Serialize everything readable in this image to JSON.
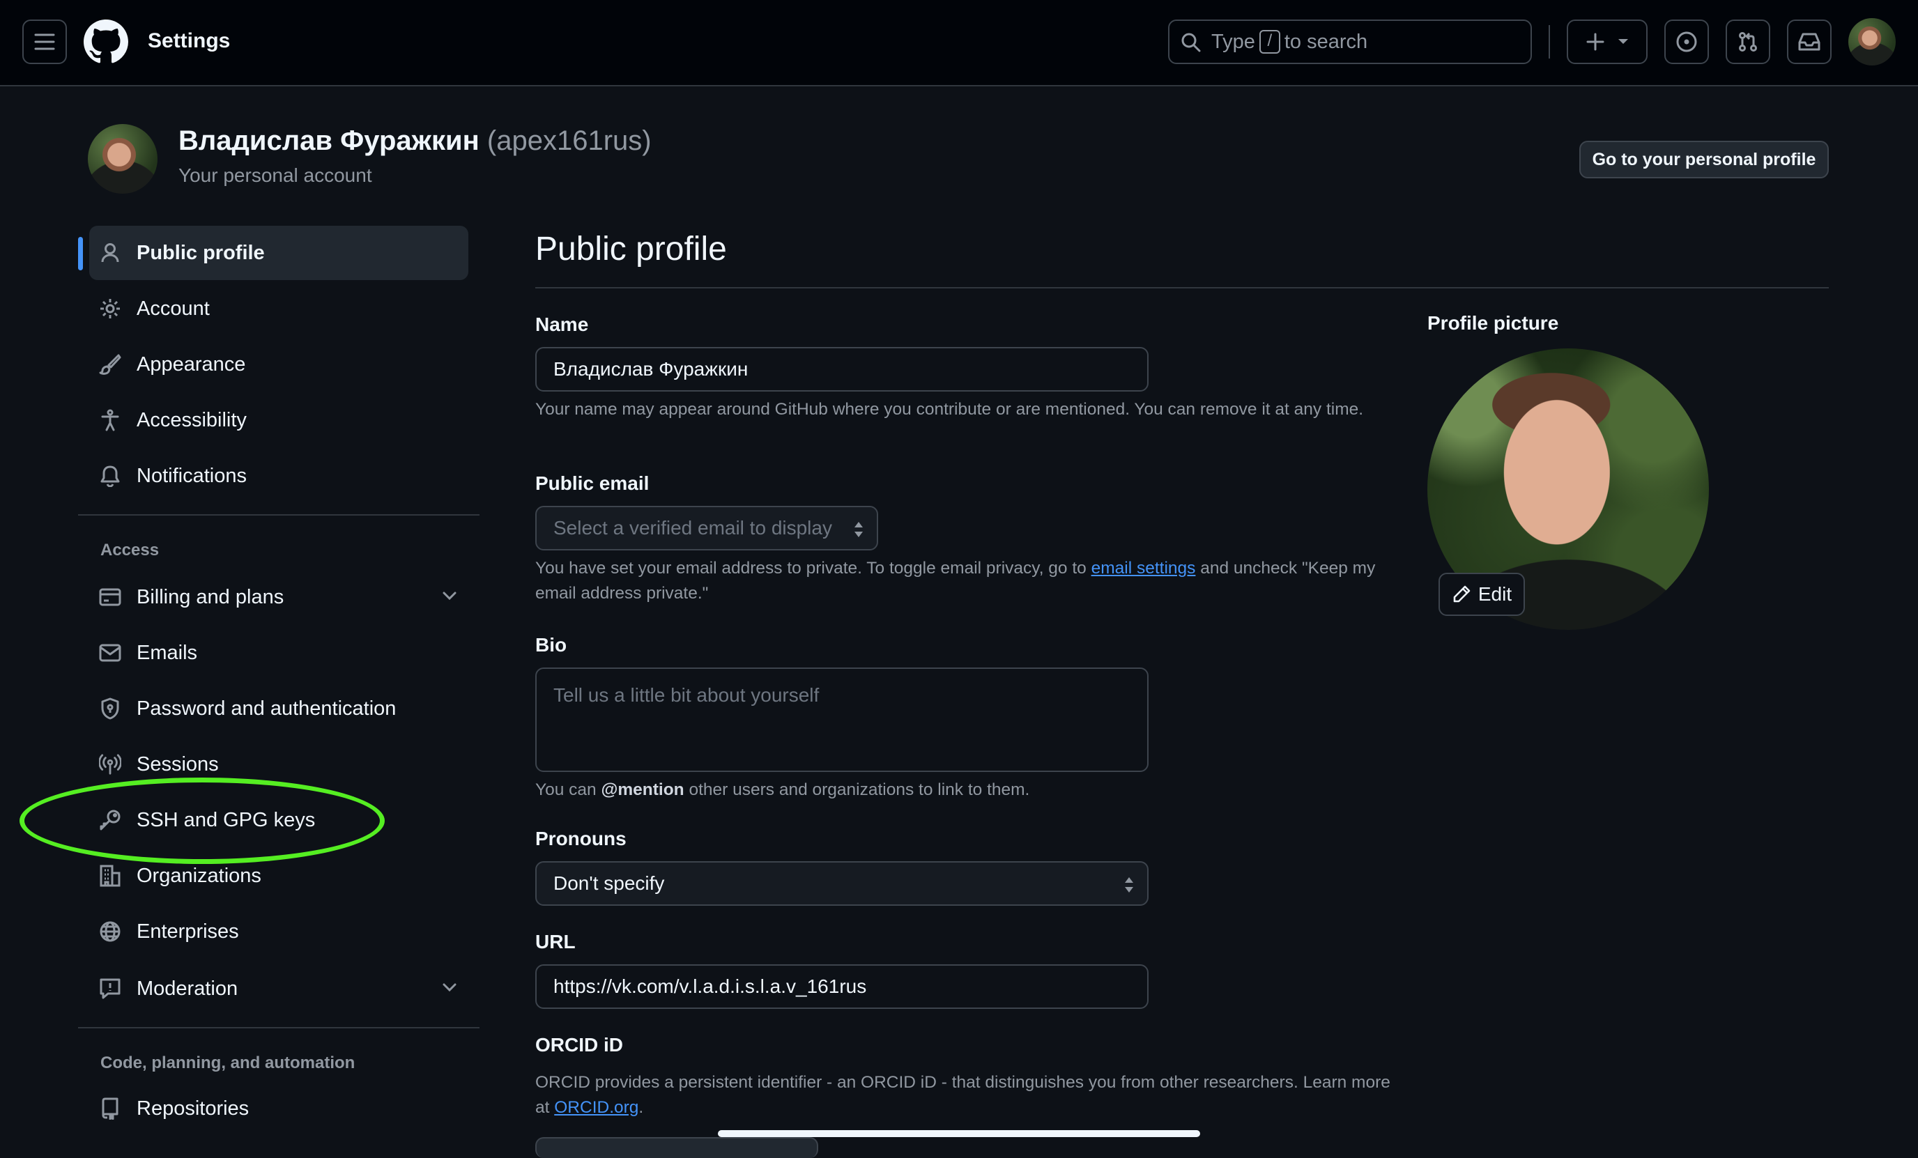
{
  "header": {
    "title": "Settings",
    "search": {
      "prefix": "Type",
      "key": "/",
      "suffix": "to search"
    }
  },
  "account": {
    "name": "Владислав Фуражкин",
    "handle": "(apex161rus)",
    "subtitle": "Your personal account",
    "profile_button": "Go to your personal profile"
  },
  "sidebar": {
    "items": [
      {
        "label": "Public profile",
        "icon": "person-icon",
        "active": true
      },
      {
        "label": "Account",
        "icon": "gear-icon"
      },
      {
        "label": "Appearance",
        "icon": "paintbrush-icon"
      },
      {
        "label": "Accessibility",
        "icon": "accessibility-icon"
      },
      {
        "label": "Notifications",
        "icon": "bell-icon"
      }
    ],
    "access_heading": "Access",
    "access_items": [
      {
        "label": "Billing and plans",
        "icon": "credit-card-icon",
        "expandable": true
      },
      {
        "label": "Emails",
        "icon": "mail-icon"
      },
      {
        "label": "Password and authentication",
        "icon": "shield-lock-icon"
      },
      {
        "label": "Sessions",
        "icon": "broadcast-icon"
      },
      {
        "label": "SSH and GPG keys",
        "icon": "key-icon"
      },
      {
        "label": "Organizations",
        "icon": "organization-icon"
      },
      {
        "label": "Enterprises",
        "icon": "globe-icon"
      },
      {
        "label": "Moderation",
        "icon": "report-icon",
        "expandable": true
      }
    ],
    "code_heading": "Code, planning, and automation",
    "code_items": [
      {
        "label": "Repositories",
        "icon": "repo-icon"
      }
    ]
  },
  "main": {
    "title": "Public profile",
    "name_label": "Name",
    "name_value": "Владислав Фуражкин",
    "name_hint": "Your name may appear around GitHub where you contribute or are mentioned. You can remove it at any time.",
    "email_label": "Public email",
    "email_placeholder": "Select a verified email to display",
    "email_hint_before": "You have set your email address to private. To toggle email privacy, go to",
    "email_hint_link": "email settings",
    "email_hint_after": "and uncheck \"Keep my email address private.\"",
    "bio_label": "Bio",
    "bio_placeholder": "Tell us a little bit about yourself",
    "bio_hint_before": "You can",
    "bio_hint_mention": "@mention",
    "bio_hint_after": "other users and organizations to link to them.",
    "pronouns_label": "Pronouns",
    "pronouns_value": "Don't specify",
    "url_label": "URL",
    "url_value": "https://vk.com/v.l.a.d.i.s.l.a.v_161rus",
    "orcid_label": "ORCID iD",
    "orcid_hint_before": "ORCID provides a persistent identifier - an ORCID iD - that distinguishes you from other researchers. Learn more at",
    "orcid_hint_link": "ORCID.org",
    "orcid_hint_after": ".",
    "picture_label": "Profile picture",
    "edit_label": "Edit"
  },
  "colors": {
    "background": "#0d1117",
    "header": "#010409",
    "accent": "#4493f8",
    "highlight": "#55ee22"
  }
}
